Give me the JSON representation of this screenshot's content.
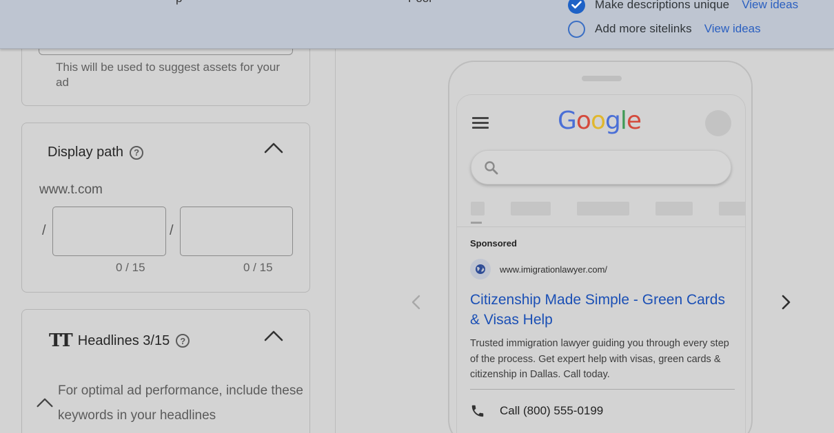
{
  "topbar": {
    "clipped_left_text": "p",
    "clipped_mid_text": "Poor",
    "suggestions": [
      {
        "label": "Make descriptions unique",
        "link": "View ideas",
        "checked": true
      },
      {
        "label": "Add more sitelinks",
        "link": "View ideas",
        "checked": false
      }
    ]
  },
  "business_card": {
    "helper": "This will be used to suggest assets for your ad"
  },
  "display_path": {
    "title": "Display path",
    "domain": "www.t.com",
    "separator": "/",
    "path1": {
      "value": "",
      "counter": "0 / 15"
    },
    "path2": {
      "value": "",
      "counter": "0 / 15"
    }
  },
  "headlines": {
    "title": "Headlines 3/15",
    "icon_text": "TT",
    "keyword_hint": "For optimal ad performance, include these keywords in your headlines"
  },
  "preview": {
    "logo": {
      "letters": [
        "G",
        "o",
        "o",
        "g",
        "l",
        "e"
      ],
      "colors": [
        "#4a6fd6",
        "#d44a3c",
        "#e0b72e",
        "#4a6fd6",
        "#3f9a55",
        "#d44a3c"
      ]
    },
    "ad": {
      "sponsored": "Sponsored",
      "url": "www.imigrationlawyer.com/",
      "headline": "Citizenship Made Simple - Green Cards & Visas Help",
      "description": "Trusted immigration lawyer guiding you through every step of the process. Get expert help with visas, green cards & citizenship in Dallas. Call today.",
      "call": "Call (800) 555-0199"
    }
  },
  "colors": {
    "accent": "#1e62c6",
    "link": "#2a5fc0",
    "ad_headline": "#1a4fb5"
  }
}
